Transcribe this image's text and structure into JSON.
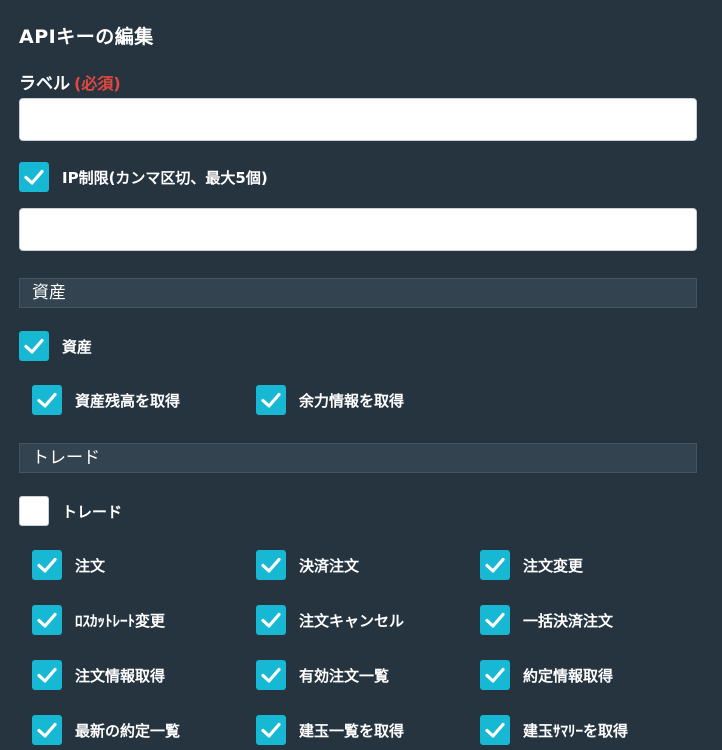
{
  "page": {
    "title": "APIキーの編集"
  },
  "label_field": {
    "label": "ラベル",
    "required": "(必須)",
    "value": ""
  },
  "ip_field": {
    "checkbox_label": "IP制限(カンマ区切、最大5個)",
    "checked": true,
    "value": ""
  },
  "sections": {
    "assets": {
      "header": "資産",
      "group_label": "資産",
      "items": [
        "資産残高を取得",
        "余力情報を取得"
      ]
    },
    "trade": {
      "header": "トレード",
      "group_label": "トレード",
      "items": [
        "注文",
        "決済注文",
        "注文変更",
        "ﾛｽｶｯﾄﾚｰﾄ変更",
        "注文キャンセル",
        "一括決済注文",
        "注文情報取得",
        "有効注文一覧",
        "約定情報取得",
        "最新の約定一覧",
        "建玉一覧を取得",
        "建玉ｻﾏﾘｰを取得"
      ]
    }
  },
  "colors": {
    "background": "#263440",
    "checkbox_checked": "#17b8d4",
    "required": "#e2483d",
    "section_bar": "#33434f"
  }
}
